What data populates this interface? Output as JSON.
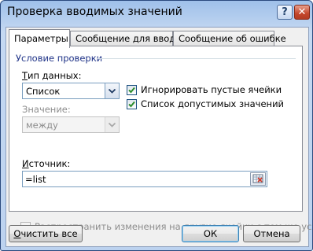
{
  "window": {
    "title": "Проверка вводимых значений",
    "help_glyph": "?",
    "close_glyph": "✕"
  },
  "tabs": [
    {
      "label": "Параметры",
      "active": true
    },
    {
      "label": "Сообщение для ввода",
      "active": false
    },
    {
      "label": "Сообщение об ошибке",
      "active": false
    }
  ],
  "group": {
    "title": "Условие проверки"
  },
  "data_type": {
    "label": "Тип данных:",
    "value": "Список"
  },
  "value_field": {
    "label": "Значение:",
    "value": "между"
  },
  "ignore_blank": {
    "label": "Игнорировать пустые ячейки",
    "checked": true
  },
  "in_cell_dropdown": {
    "label": "Список допустимых значений",
    "checked": true
  },
  "source": {
    "label": "Источник:",
    "value": "=list"
  },
  "apply_all": {
    "label": "Распространить изменения на другие ячейки с тем же условием",
    "checked": false
  },
  "buttons": {
    "clear": "Очистить все",
    "ok": "ОК",
    "cancel": "Отмена"
  },
  "colors": {
    "group_title": "#1e3287",
    "check": "#2d8d2d"
  }
}
